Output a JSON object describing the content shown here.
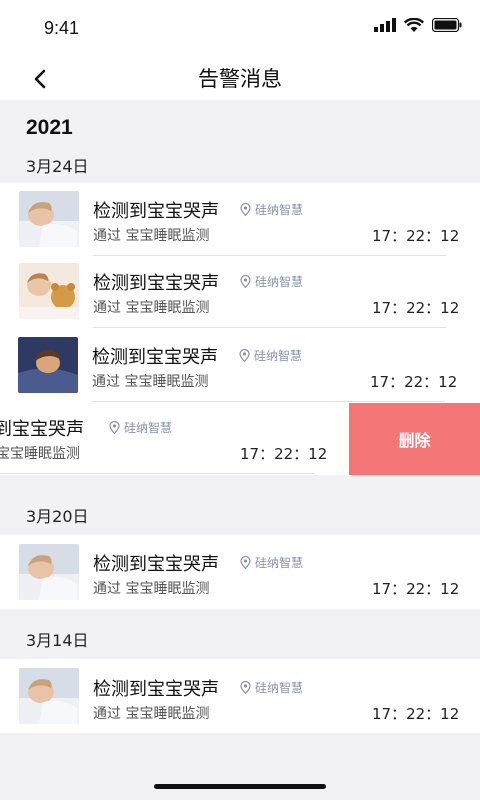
{
  "status_bar": {
    "time": "9:41"
  },
  "header": {
    "title": "告警消息"
  },
  "year": "2021",
  "groups": [
    {
      "date": "3月24日",
      "items": [
        {
          "title": "检测到宝宝哭声",
          "tag": "硅纳智慧",
          "source": "通过 宝宝睡眠监测",
          "time": "17：22：12"
        },
        {
          "title": "检测到宝宝哭声",
          "tag": "硅纳智慧",
          "source": "通过 宝宝睡眠监测",
          "time": "17：22：12"
        },
        {
          "title": "检测到宝宝哭声",
          "tag": "硅纳智慧",
          "source": "通过 宝宝睡眠监测",
          "time": "17：22：12"
        },
        {
          "title": "到宝宝哭声",
          "tag": "硅纳智慧",
          "source": "宝宝睡眠监测",
          "time": "17：22：12",
          "action": "删除"
        }
      ]
    },
    {
      "date": "3月20日",
      "items": [
        {
          "title": "检测到宝宝哭声",
          "tag": "硅纳智慧",
          "source": "通过 宝宝睡眠监测",
          "time": "17：22：12"
        }
      ]
    },
    {
      "date": "3月14日",
      "items": [
        {
          "title": "检测到宝宝哭声",
          "tag": "硅纳智慧",
          "source": "通过 宝宝睡眠监测",
          "time": "17：22：12"
        }
      ]
    }
  ],
  "colors": {
    "delete": "#f47575",
    "tag": "#8792a8",
    "background": "#f2f2f4"
  },
  "icons": [
    "back-chevron-icon",
    "location-pin-icon",
    "signal-icon",
    "wifi-icon",
    "battery-icon"
  ]
}
